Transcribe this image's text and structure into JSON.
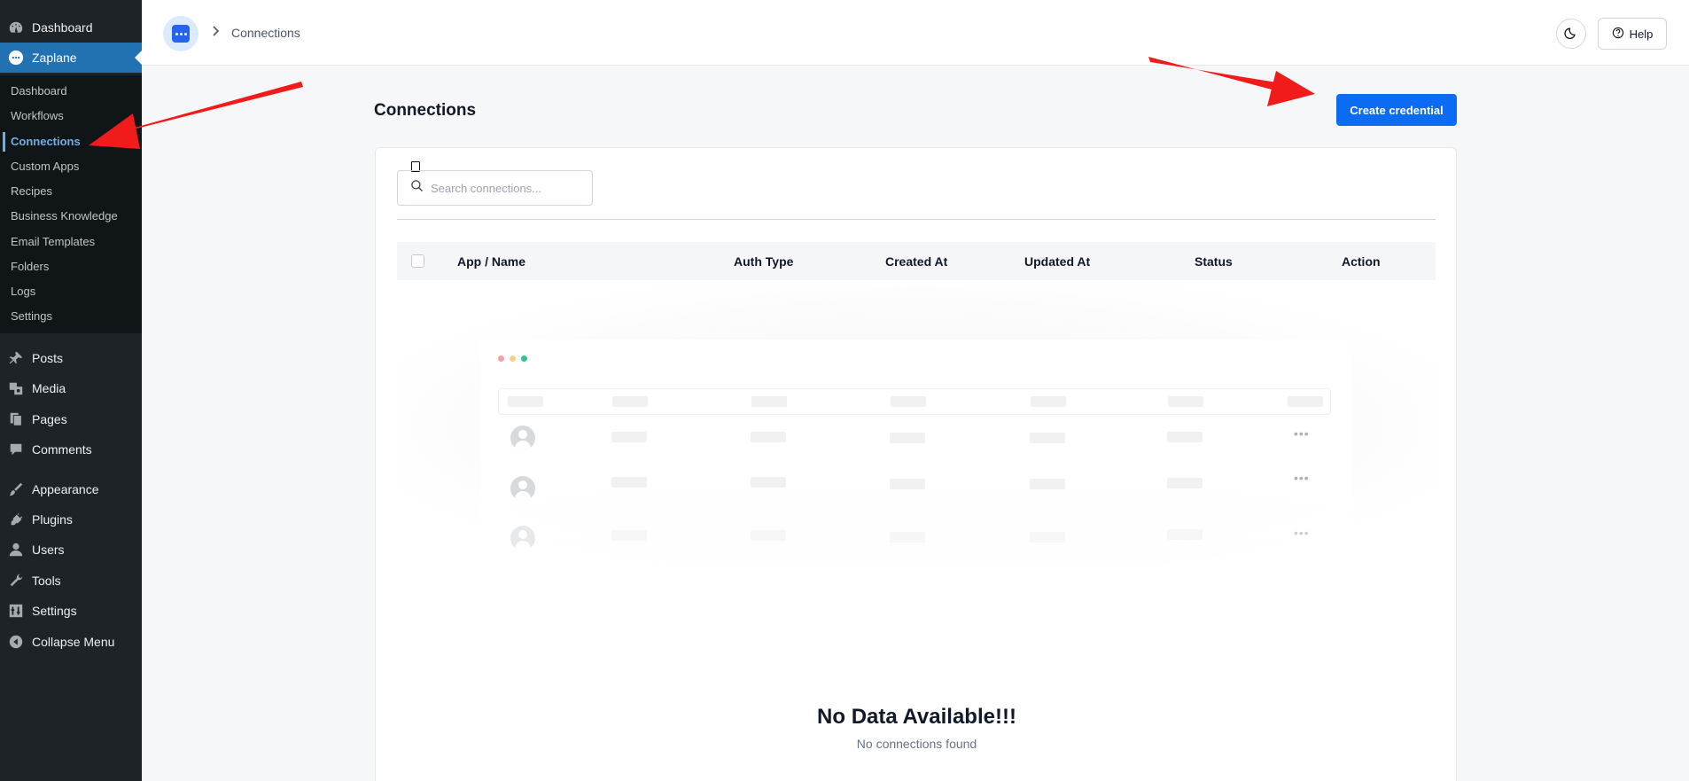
{
  "sidebar": {
    "top_items": [
      {
        "label": "Dashboard",
        "icon": "dashboard-icon"
      },
      {
        "label": "Zaplane",
        "icon": "zaplane-icon"
      }
    ],
    "submenu": [
      "Dashboard",
      "Workflows",
      "Connections",
      "Custom Apps",
      "Recipes",
      "Business Knowledge",
      "Email Templates",
      "Folders",
      "Logs",
      "Settings"
    ],
    "current_submenu": "Connections",
    "bottom_items": [
      {
        "label": "Posts",
        "icon": "pin-icon"
      },
      {
        "label": "Media",
        "icon": "media-icon"
      },
      {
        "label": "Pages",
        "icon": "pages-icon"
      },
      {
        "label": "Comments",
        "icon": "comment-icon"
      },
      {
        "label": "Appearance",
        "icon": "brush-icon"
      },
      {
        "label": "Plugins",
        "icon": "plug-icon"
      },
      {
        "label": "Users",
        "icon": "user-icon"
      },
      {
        "label": "Tools",
        "icon": "wrench-icon"
      },
      {
        "label": "Settings",
        "icon": "settings-icon"
      },
      {
        "label": "Collapse Menu",
        "icon": "collapse-icon"
      }
    ]
  },
  "topbar": {
    "breadcrumb": "Connections",
    "help_label": "Help"
  },
  "page": {
    "title": "Connections",
    "create_button": "Create credential",
    "search_placeholder": "Search connections...",
    "columns": [
      "App / Name",
      "Auth Type",
      "Created At",
      "Updated At",
      "Status",
      "Action"
    ],
    "empty_title": "No Data Available!!!",
    "empty_subtitle": "No connections found"
  },
  "colors": {
    "sidebar_bg": "#1d2327",
    "accent": "#0b6bf2",
    "annotation_arrow": "#f21b1b"
  }
}
